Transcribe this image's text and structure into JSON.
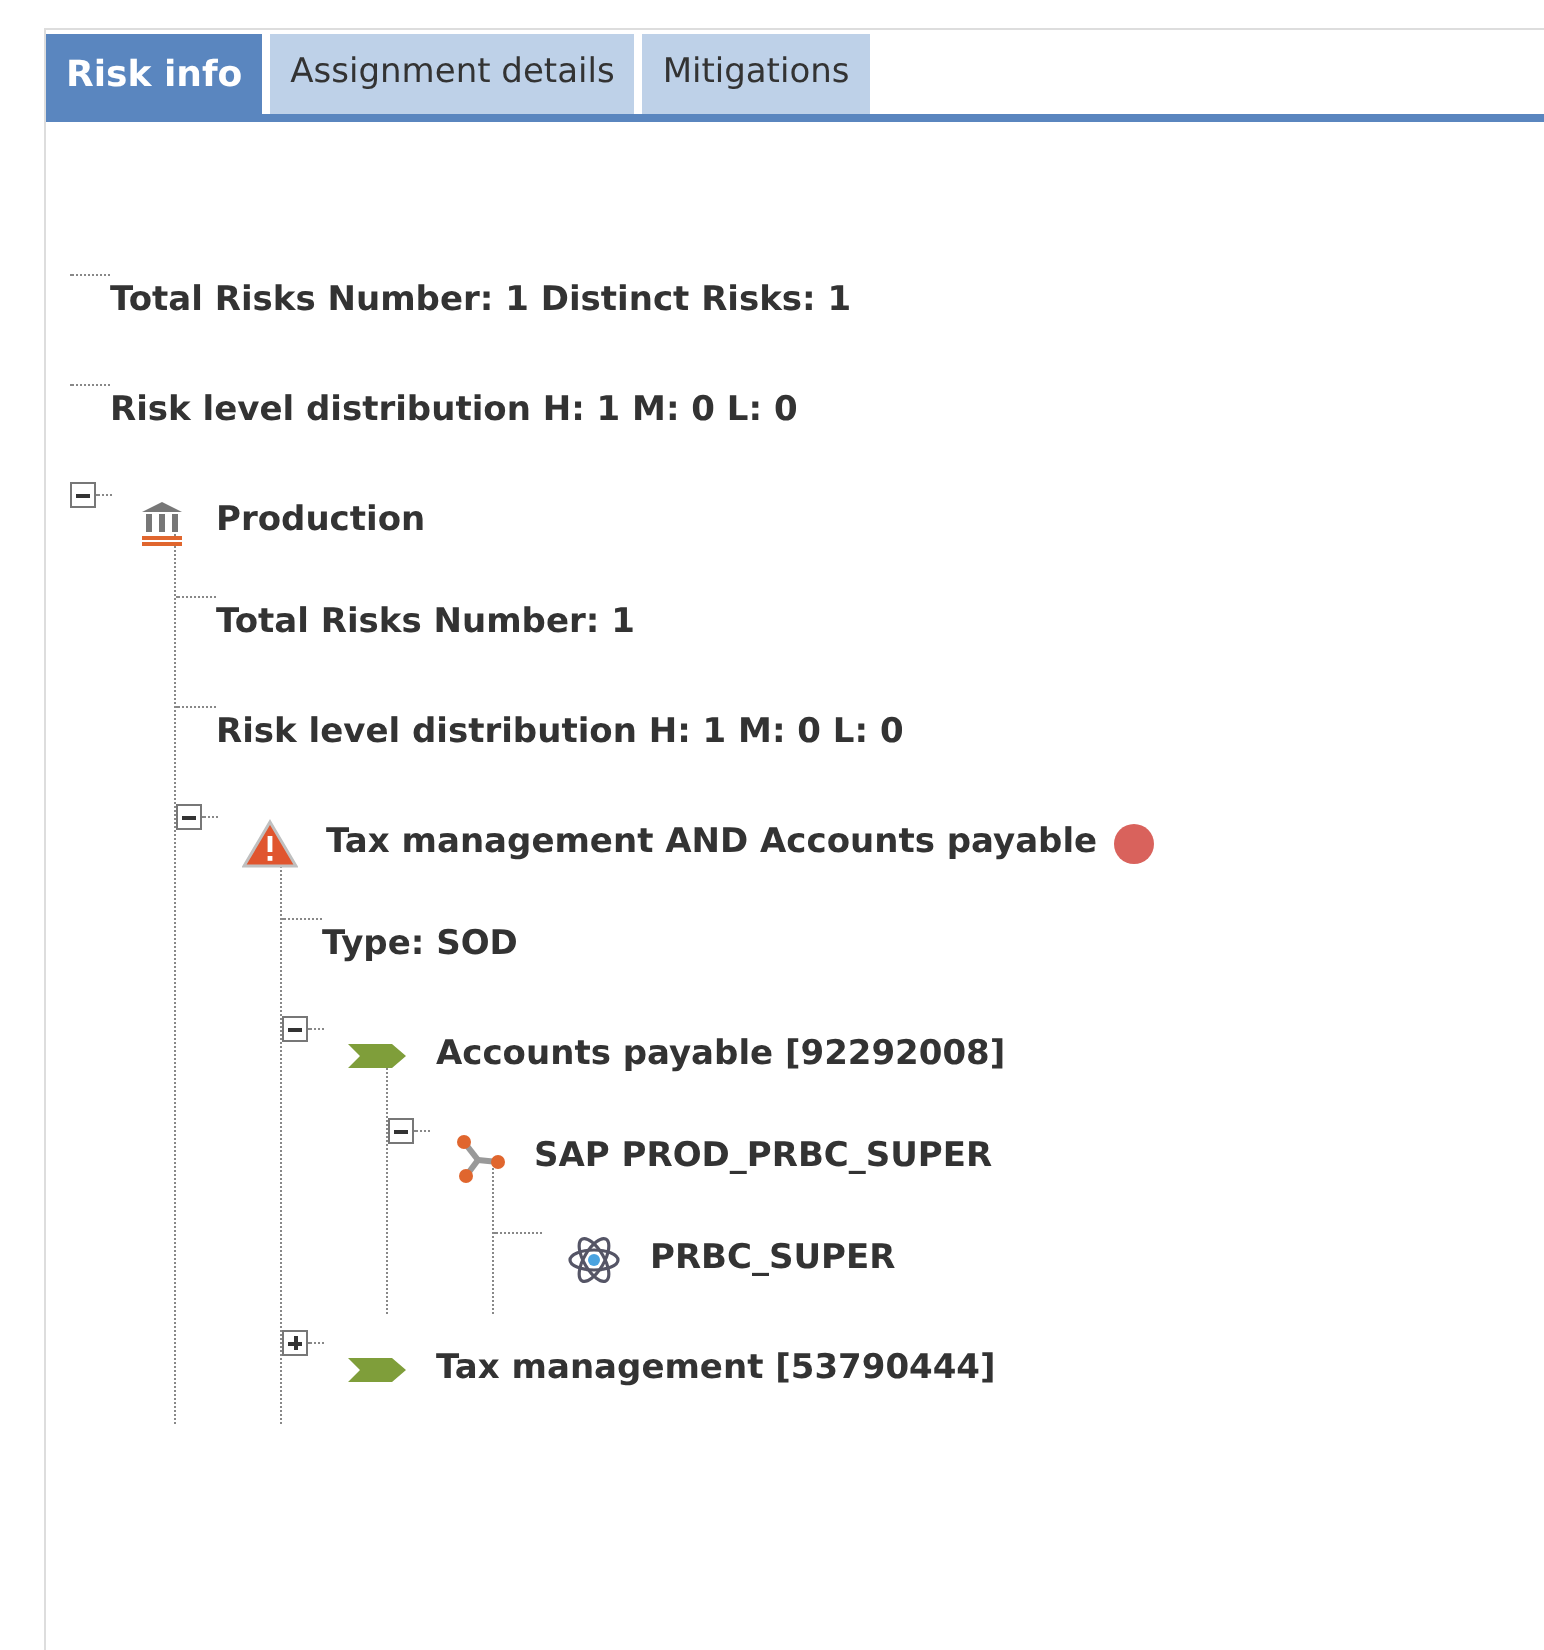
{
  "tabs": [
    {
      "label": "Risk info",
      "selected": true
    },
    {
      "label": "Assignment details",
      "selected": false
    },
    {
      "label": "Mitigations",
      "selected": false
    }
  ],
  "tree": [
    {
      "kind": "text",
      "label": "Total Risks Number: 1 Distinct Risks: 1"
    },
    {
      "kind": "text",
      "label": "Risk level distribution H: 1 M: 0 L: 0"
    },
    {
      "kind": "system",
      "label": "Production",
      "expanded": true,
      "children": [
        {
          "kind": "text",
          "label": "Total Risks Number: 1"
        },
        {
          "kind": "text",
          "label": "Risk level distribution H: 1 M: 0 L: 0"
        },
        {
          "kind": "risk",
          "label": "Tax management AND Accounts payable",
          "color": "#d9625c",
          "expanded": true,
          "children": [
            {
              "kind": "text",
              "label": "Type: SOD"
            },
            {
              "kind": "function",
              "label": "Accounts payable [92292008]",
              "expanded": true,
              "children": [
                {
                  "kind": "account",
                  "label": "SAP PROD_PRBC_SUPER",
                  "expanded": true,
                  "children": [
                    {
                      "kind": "role",
                      "label": "PRBC_SUPER"
                    }
                  ]
                }
              ]
            },
            {
              "kind": "function",
              "label": "Tax management [53790444]",
              "expanded": false
            }
          ]
        }
      ]
    }
  ]
}
